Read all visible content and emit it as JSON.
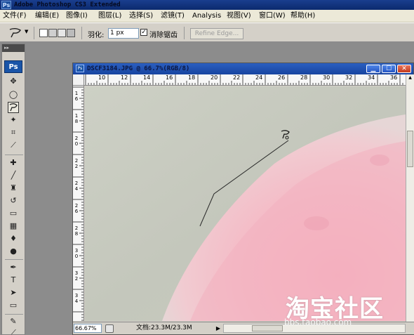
{
  "app": {
    "title": "Adobe Photoshop CS3 Extended",
    "badge": "Ps"
  },
  "menu": [
    {
      "label": "文件(F)"
    },
    {
      "label": "编辑(E)"
    },
    {
      "label": "图像(I)"
    },
    {
      "label": "图层(L)"
    },
    {
      "label": "选择(S)"
    },
    {
      "label": "滤镜(T)"
    },
    {
      "label": "Analysis"
    },
    {
      "label": "视图(V)"
    },
    {
      "label": "窗口(W)"
    },
    {
      "label": "帮助(H)"
    }
  ],
  "options": {
    "feather_label": "羽化:",
    "feather_value": "1 px",
    "antialias_label": "消除锯齿",
    "antialias_checked": true,
    "refine_edge": "Refine Edge..."
  },
  "toolbox": {
    "grip": "▸▸",
    "logo": "Ps"
  },
  "document": {
    "title": "DSCF3184.JPG @ 66.7%(RGB/8)",
    "minimize": "▁",
    "maximize": "☐",
    "close": "✕",
    "ruler_h": [
      "10",
      "12",
      "14",
      "16",
      "18",
      "20",
      "22",
      "24",
      "26",
      "28",
      "30",
      "32",
      "34",
      "36"
    ],
    "ruler_v": [
      "1\n6",
      "1\n8",
      "2\n0",
      "2\n2",
      "2\n4",
      "2\n6",
      "2\n8",
      "3\n0",
      "3\n2",
      "3\n4"
    ]
  },
  "status": {
    "zoom": "66.67%",
    "doc_label": "文档:23.3M/23.3M",
    "arrow": "▶"
  },
  "watermark": {
    "logo": "淘宝社区",
    "url": "bbs.taobao.com"
  },
  "colors": {
    "title_bar": "#0b2a6e",
    "doc_title_bar": "#1744a0",
    "canvas_bg": "#c9cbc0",
    "pink_fur": "#f4b9c4"
  }
}
